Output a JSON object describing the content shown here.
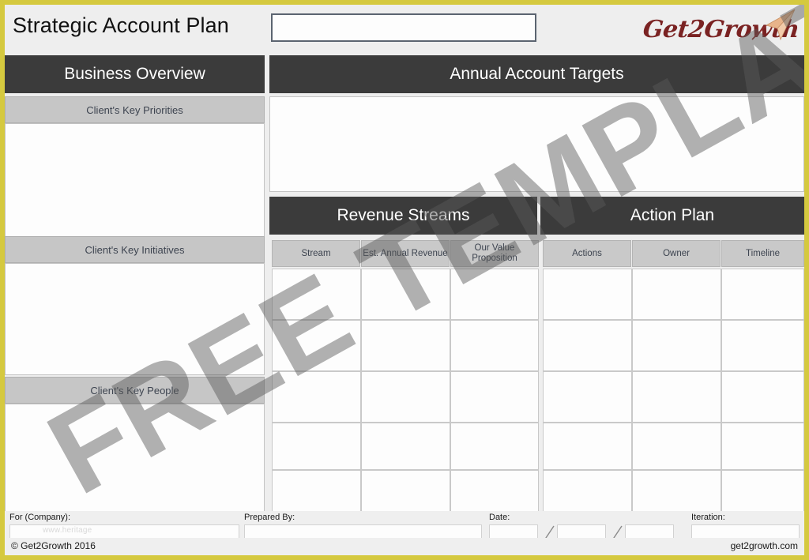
{
  "document": {
    "title": "Strategic Account Plan",
    "account_name_value": "",
    "account_name_placeholder": ""
  },
  "brand": {
    "logo_text": "Get2Growth",
    "logo_icon": "paper-plane-icon",
    "accent_border_color": "#d5c93f",
    "header_bar_color": "#3b3b3b",
    "subheader_color": "#c6c6c6",
    "logo_color": "#7a2222"
  },
  "watermark": {
    "text": "FREE TEMPLATE",
    "faint_text": "www.heritage"
  },
  "left_column": {
    "band_label": "Business Overview",
    "sections": [
      {
        "label": "Client's Key Priorities",
        "value": ""
      },
      {
        "label": "Client's Key Initiatives",
        "value": ""
      },
      {
        "label": "Client's Key People",
        "value": ""
      }
    ]
  },
  "right_column": {
    "targets_band_label": "Annual Account Targets",
    "targets_value": "",
    "revenue_band_label": "Revenue Streams",
    "action_band_label": "Action Plan",
    "revenue_columns": [
      "Stream",
      "Est. Annual Revenue",
      "Our Value Proposition"
    ],
    "action_columns": [
      "Actions",
      "Owner",
      "Timeline"
    ],
    "row_count": 5
  },
  "footer": {
    "company_label": "For (Company):",
    "company_value": "",
    "prepared_by_label": "Prepared By:",
    "prepared_by_value": "",
    "date_label": "Date:",
    "date_day": "",
    "date_month": "",
    "date_year": "",
    "iteration_label": "Iteration:",
    "iteration_value": "",
    "copyright": "© Get2Growth 2016",
    "website": "get2growth.com"
  }
}
